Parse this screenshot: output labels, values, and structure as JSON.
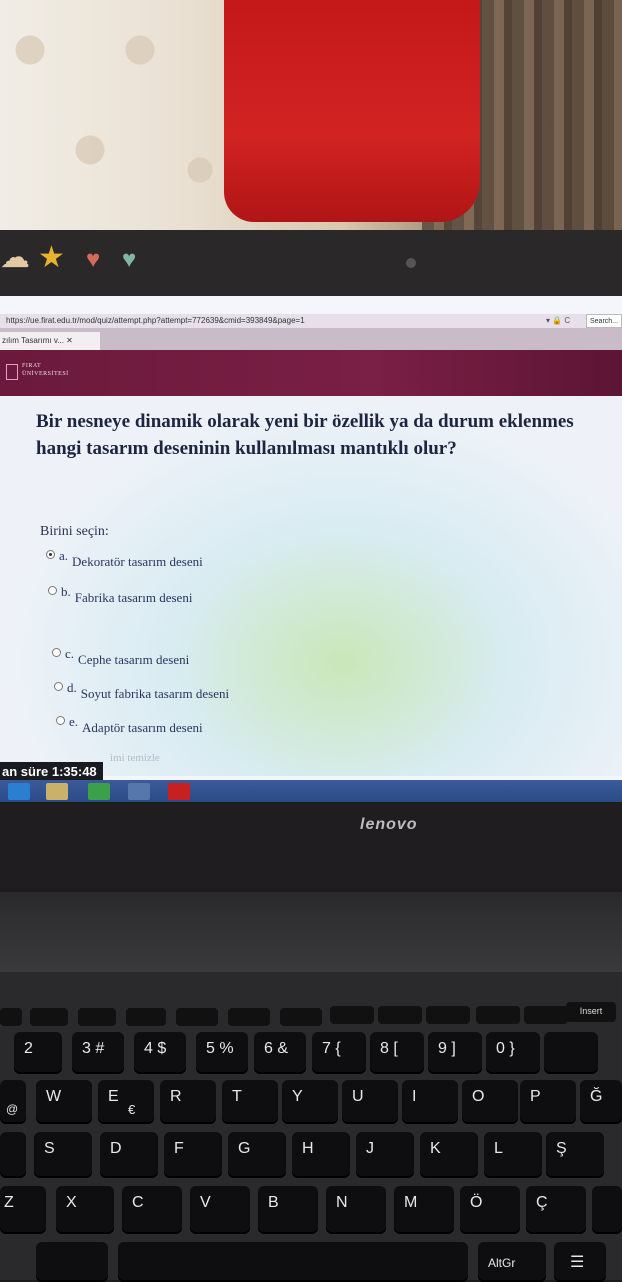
{
  "browser": {
    "url": "https://ue.firat.edu.tr/mod/quiz/attempt.php?attempt=772639&cmid=393849&page=1",
    "search_placeholder": "Search...",
    "tab_title": "zılım Tasarımı v... ✕"
  },
  "site": {
    "logo_line1": "FIRAT",
    "logo_line2": "ÜNİVERSİTESİ"
  },
  "quiz": {
    "question_line1": "Bir nesneye dinamik olarak yeni bir özellik ya da durum eklenmes",
    "question_line2": "hangi tasarım deseninin kullanılması mantıklı olur?",
    "prompt": "Birini seçin:",
    "options": [
      {
        "letter": "a.",
        "text": "Dekoratör tasarım deseni",
        "selected": true
      },
      {
        "letter": "b.",
        "text": "Fabrika tasarım deseni",
        "selected": false
      },
      {
        "letter": "c.",
        "text": "Cephe tasarım deseni",
        "selected": false
      },
      {
        "letter": "d.",
        "text": "Soyut fabrika tasarım deseni",
        "selected": false
      },
      {
        "letter": "e.",
        "text": "Adaptör tasarım deseni",
        "selected": false
      }
    ],
    "clear_label": "imi temizle",
    "timer": "an süre 1:35:48"
  },
  "laptop": {
    "brand": "lenovo"
  },
  "keyboard": {
    "insert": "Insert",
    "row_numbers": [
      "2",
      "3 #",
      "4 $",
      "5 %",
      "6 &",
      "7 {",
      "8 [",
      "9 ]",
      "0 }"
    ],
    "row_qwerty": [
      "W",
      "E",
      "R",
      "T",
      "Y",
      "U",
      "I",
      "O",
      "P",
      "Ğ"
    ],
    "row_asdf": [
      "S",
      "D",
      "F",
      "G",
      "H",
      "J",
      "K",
      "L",
      "Ş"
    ],
    "row_zxcv": [
      "Z",
      "X",
      "C",
      "V",
      "B",
      "N",
      "M",
      "Ö",
      "Ç"
    ],
    "euro": "€",
    "at": "@",
    "altgr": "AltGr"
  }
}
